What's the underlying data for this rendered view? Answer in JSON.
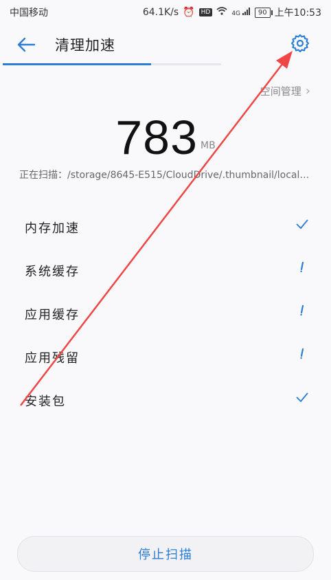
{
  "status_bar": {
    "carrier": "中国移动",
    "speed": "64.1K/s",
    "hd": "HD",
    "network": "4G",
    "battery": "90",
    "time": "上午10:53"
  },
  "header": {
    "title": "清理加速",
    "progress": 0.68
  },
  "space_management": "空间管理",
  "scan": {
    "size_value": "783",
    "size_unit": "MB",
    "path": "正在扫描：/storage/8645-E515/CloudDrive/.thumbnail/local…"
  },
  "items": [
    {
      "label": "内存加速",
      "status": "done"
    },
    {
      "label": "系统缓存",
      "status": "scanning"
    },
    {
      "label": "应用缓存",
      "status": "scanning"
    },
    {
      "label": "应用残留",
      "status": "scanning"
    },
    {
      "label": "安装包",
      "status": "done"
    }
  ],
  "stop_button": "停止扫描",
  "colors": {
    "accent": "#2a7dd6",
    "annotation_arrow": "#f04646"
  }
}
